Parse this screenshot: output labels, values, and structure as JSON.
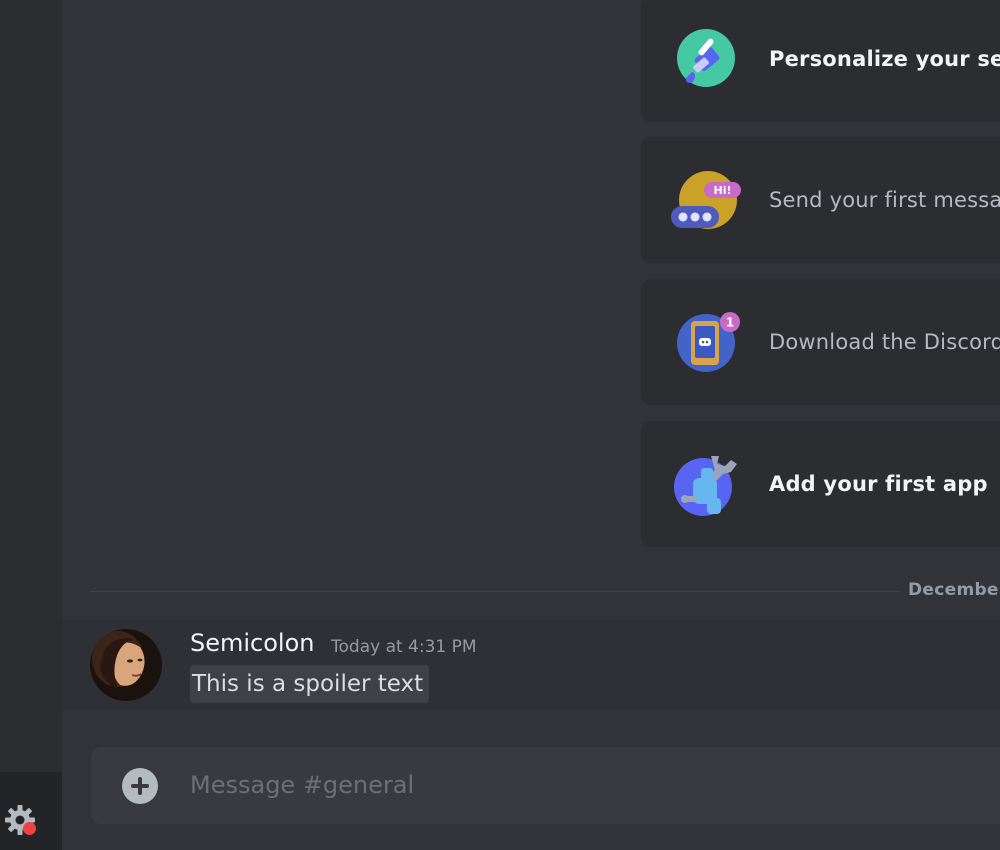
{
  "onboarding": {
    "items": [
      {
        "label": "Personalize your server",
        "icon": "paintbrush-icon",
        "completed": true
      },
      {
        "label": "Send your first message",
        "icon": "chat-bubble-icon",
        "badge": "Hi!",
        "completed": false
      },
      {
        "label": "Download the Discord app",
        "icon": "phone-icon",
        "notification": "1",
        "completed": false
      },
      {
        "label": "Add your first app",
        "icon": "wrench-icon",
        "completed": true
      }
    ]
  },
  "divider": {
    "date_label": "December"
  },
  "message": {
    "author": "Semicolon",
    "timestamp": "Today at 4:31 PM",
    "content": "This is a spoiler text",
    "avatar_icon": "user-avatar"
  },
  "composer": {
    "placeholder": "Message #general",
    "value": ""
  },
  "user_panel": {
    "settings_icon": "gear-icon",
    "status_color": "#f23f43"
  },
  "colors": {
    "background": "#313338",
    "card": "#2b2d31",
    "composer": "#383a40",
    "text_primary": "#f2f3f5",
    "text_muted": "#949ba4",
    "status_red": "#f23f43"
  }
}
